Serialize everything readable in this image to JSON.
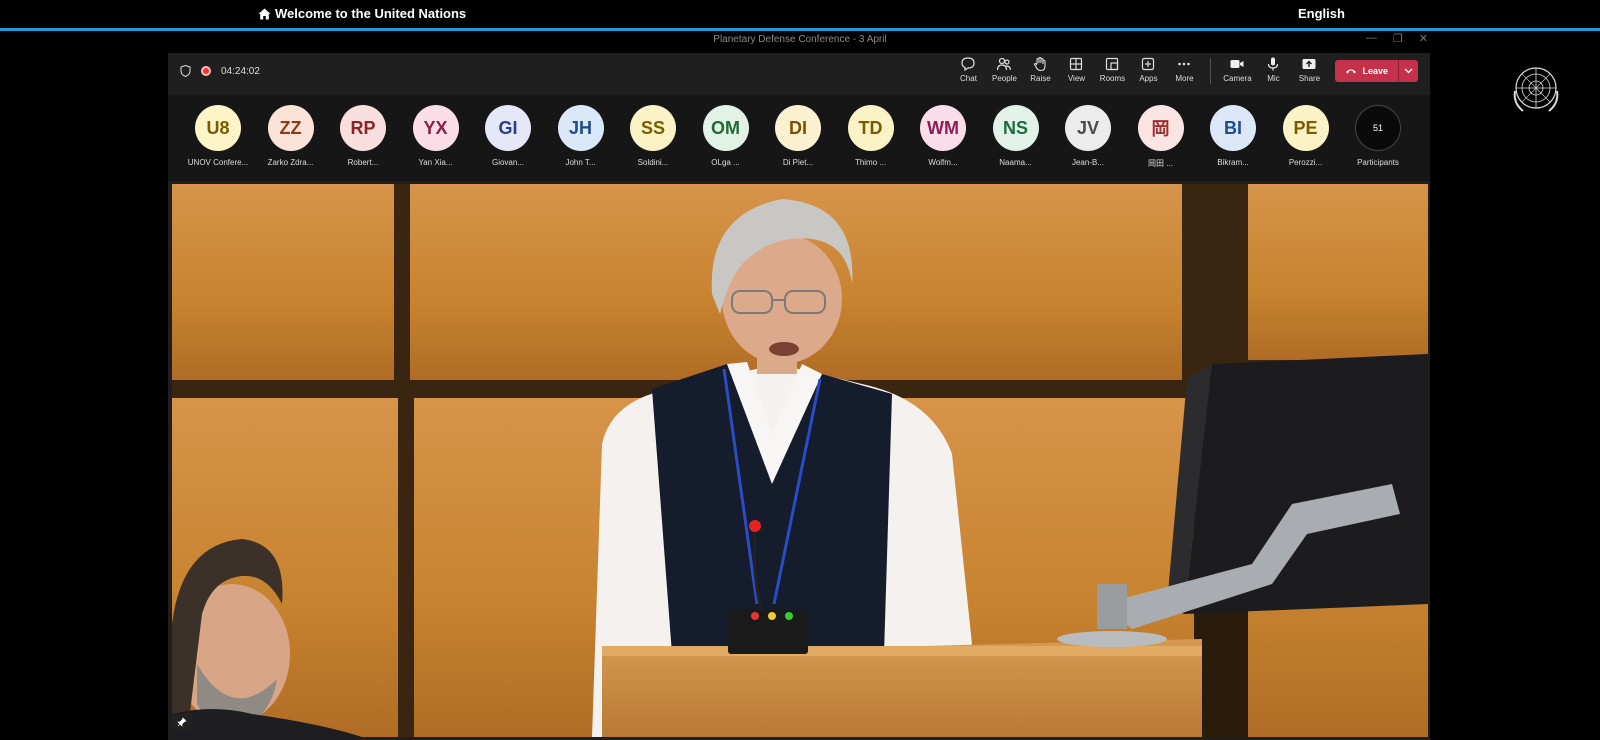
{
  "site": {
    "title": "Welcome to the United Nations",
    "language": "English",
    "accent_color": "#1e9ad6"
  },
  "window": {
    "title": "Planetary Defense Conference - 3 April"
  },
  "toolbar": {
    "timer": "04:24:02",
    "buttons": [
      {
        "label": "Chat",
        "icon": "chat-icon"
      },
      {
        "label": "People",
        "icon": "people-icon"
      },
      {
        "label": "Raise",
        "icon": "hand-icon"
      },
      {
        "label": "View",
        "icon": "grid-icon"
      },
      {
        "label": "Rooms",
        "icon": "rooms-icon"
      },
      {
        "label": "Apps",
        "icon": "apps-icon"
      },
      {
        "label": "More",
        "icon": "more-icon"
      },
      {
        "label": "Camera",
        "icon": "camera-icon"
      },
      {
        "label": "Mic",
        "icon": "mic-icon"
      },
      {
        "label": "Share",
        "icon": "share-icon"
      }
    ],
    "leave_label": "Leave",
    "leave_color": "#c4314b"
  },
  "participants": {
    "items": [
      {
        "initials": "U8",
        "name": "UNOV Confere...",
        "bg": "#fdf4c8",
        "fg": "#7a5c00"
      },
      {
        "initials": "ZZ",
        "name": "Zarko Zdra...",
        "bg": "#fbe3d8",
        "fg": "#8a3a1a"
      },
      {
        "initials": "RP",
        "name": "Robert...",
        "bg": "#f9dede",
        "fg": "#8a2323"
      },
      {
        "initials": "YX",
        "name": "Yan Xia...",
        "bg": "#fadde6",
        "fg": "#8c1f48"
      },
      {
        "initials": "GI",
        "name": "Giovan...",
        "bg": "#e6e8f7",
        "fg": "#2e3a8a"
      },
      {
        "initials": "JH",
        "name": "John T...",
        "bg": "#dbe8f7",
        "fg": "#1f4c8a"
      },
      {
        "initials": "SS",
        "name": "Soldini...",
        "bg": "#fbf2c6",
        "fg": "#7a5c00"
      },
      {
        "initials": "OM",
        "name": "OLga ...",
        "bg": "#e2f2e6",
        "fg": "#1f6a35"
      },
      {
        "initials": "DI",
        "name": "Di Piet...",
        "bg": "#fbf0cf",
        "fg": "#7a5200"
      },
      {
        "initials": "TD",
        "name": "Thimo ...",
        "bg": "#fbf2c6",
        "fg": "#7a5c00"
      },
      {
        "initials": "WM",
        "name": "Wolfm...",
        "bg": "#f9dde9",
        "fg": "#8a1f55"
      },
      {
        "initials": "NS",
        "name": "Naama...",
        "bg": "#e2f2e8",
        "fg": "#1f6a3f"
      },
      {
        "initials": "JV",
        "name": "Jean-B...",
        "bg": "#ececec",
        "fg": "#4a4a4a"
      },
      {
        "initials": "岡",
        "name": "岡田 ...",
        "bg": "#fbe4e4",
        "fg": "#a03030"
      },
      {
        "initials": "BI",
        "name": "Bikram...",
        "bg": "#dce8f7",
        "fg": "#1f4c8a"
      },
      {
        "initials": "PE",
        "name": "Perozzi...",
        "bg": "#fbf2c6",
        "fg": "#7a5c00"
      }
    ],
    "count": "51",
    "count_label": "Participants"
  },
  "video": {
    "description_colors": {
      "wood": "#c5812f",
      "seam": "#3a2510"
    }
  }
}
